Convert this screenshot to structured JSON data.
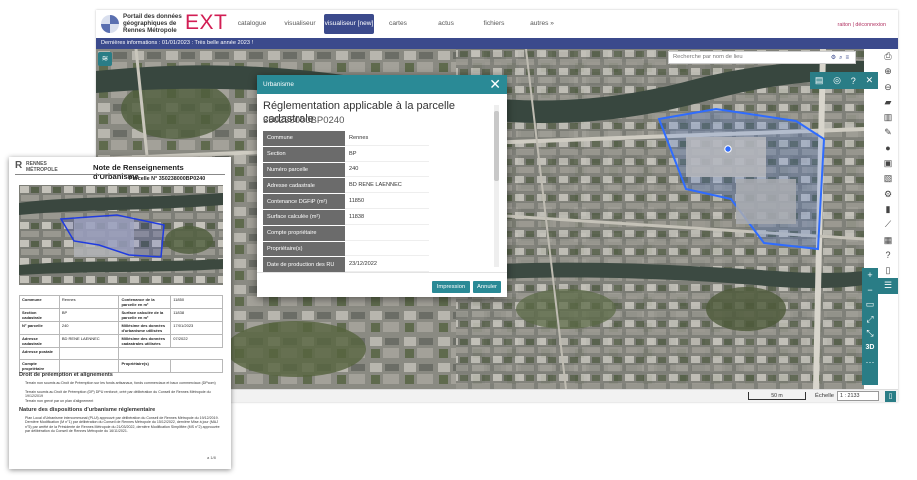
{
  "portal": {
    "logo_text": "Portail des données géographiques de Rennes Métropole",
    "logo_ext": "EXT",
    "nav": [
      "catalogue",
      "visualiseur",
      "visualiseur [new]",
      "cartes",
      "actus",
      "fichiers",
      "autres »"
    ],
    "nav_active_index": 2,
    "user_links": "raiton | déconnexion",
    "info_bar": "Dernières informations :     01/01/2023 : Très belle année 2023 !",
    "search_placeholder": "Recherche par nom de lieu",
    "scale_label": "50 m",
    "echelle_label": "Échelle",
    "echelle_value": "1 : 2133",
    "right_toolbar_icons": [
      "print-icon",
      "zoom-in-circle-icon",
      "zoom-out-circle-icon",
      "folder-open-icon",
      "columns-icon",
      "pencil-icon",
      "info-icon",
      "save-icon",
      "map-icon",
      "gear-icon",
      "chart-bar-icon",
      "line-chart-icon",
      "table-icon",
      "help-icon",
      "trash-icon",
      "list-icon"
    ],
    "map_controls": [
      "+",
      "−",
      "▭",
      "⤢",
      "⤡",
      "3D",
      "···"
    ]
  },
  "dialog": {
    "header": "Urbanisme",
    "title": "Réglementation applicable à la parcelle cadastrale",
    "parcel_id": "350238000BP0240",
    "rows": [
      {
        "label": "Commune",
        "value": "Rennes"
      },
      {
        "label": "Section",
        "value": "BP"
      },
      {
        "label": "Numéro parcelle",
        "value": "240"
      },
      {
        "label": "Adresse cadastrale",
        "value": "BD RENE LAENNEC"
      },
      {
        "label": "Contenance DGFiP (m²)",
        "value": "11850"
      },
      {
        "label": "Surface calculée (m²)",
        "value": "11838"
      },
      {
        "label": "Compte propriétaire",
        "value": ""
      },
      {
        "label": "Propriétaire(s)",
        "value": ""
      },
      {
        "label": "Date de production des RU",
        "value": "23/12/2022"
      }
    ],
    "print_label": "Impression",
    "cancel_label": "Annuler"
  },
  "note": {
    "logo_text": "RENNES MÉTROPOLE",
    "title": "Note de Renseignements d'Urbanisme",
    "parcel_line": "Parcelle N° 350238000BP0240",
    "table": [
      [
        "Commune",
        "Rennes",
        "Contenance de la parcelle en m²",
        "11850"
      ],
      [
        "Section cadastrale",
        "BP",
        "Surface calculée de la parcelle en m²",
        "11838"
      ],
      [
        "N° parcelle",
        "240",
        "Millésime des données d'urbanisme utilisées",
        "17/01/2023"
      ],
      [
        "Adresse cadastrale",
        "BD RENE LAENNEC",
        "Millésime des données cadastrales utilisées",
        "07/2022"
      ],
      [
        "Adresse postale",
        "",
        "",
        ""
      ],
      [
        "Compte propriétaire",
        "",
        "Propriétaire(s)",
        ""
      ]
    ],
    "section1_title": "Droit de préemption et alignements",
    "section1_lines": [
      "Terrain non soumis au Droit de Préemption sur les fonds artisanaux, fonds commerciaux et baux commerciaux (DPcom)",
      "Terrain soumis au Droit de Préemption (DP) DPU renforcé, créé par délibération du Conseil de Rennes Métropole du 19/12/2019",
      "Terrain non grevé par un plan d'alignement"
    ],
    "section2_title": "Nature des dispositions d'urbanisme réglementaire",
    "section2_lines": [
      "Plan Local d'Urbanisme intercommunal (PLUi) approuvé par délibération du Conseil de Rennes Métropole du 19/12/2019. Dernière Modification (M n°1) par délibération du Conseil de Rennes Métropole du 15/12/2022, dernière Mise à jour (MAJ n°5) par arrêté de la Présidente de Rennes Métropole du 21/03/2022, dernière Modification Simplifiée (MS n°2) approuvée par délibération du Conseil de Rennes Métropole du 16/11/2021."
    ],
    "page_number": "a 1/8"
  }
}
